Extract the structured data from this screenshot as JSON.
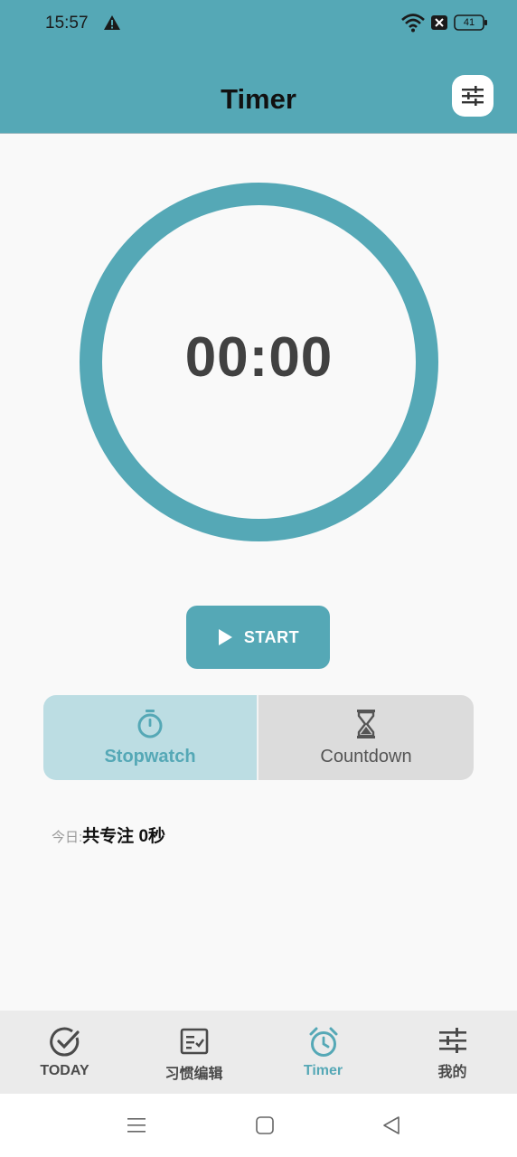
{
  "status_bar": {
    "time": "15:57",
    "battery": "41"
  },
  "header": {
    "title": "Timer"
  },
  "timer": {
    "display": "00:00"
  },
  "start_button": {
    "label": "START"
  },
  "modes": {
    "stopwatch": "Stopwatch",
    "countdown": "Countdown",
    "selected": "Stopwatch"
  },
  "today": {
    "prefix": "今日:",
    "value": "共专注 0秒"
  },
  "bottom_nav": {
    "items": [
      {
        "label": "TODAY",
        "icon": "check-circle-icon"
      },
      {
        "label": "习惯编辑",
        "icon": "checklist-icon"
      },
      {
        "label": "Timer",
        "icon": "alarm-clock-icon"
      },
      {
        "label": "我的",
        "icon": "sliders-icon"
      }
    ],
    "active": "Timer"
  },
  "colors": {
    "accent": "#55a8b6",
    "accent_light": "#bcdde3",
    "inactive_tab": "#dcdcdc",
    "nav_bg": "#ebebeb"
  }
}
